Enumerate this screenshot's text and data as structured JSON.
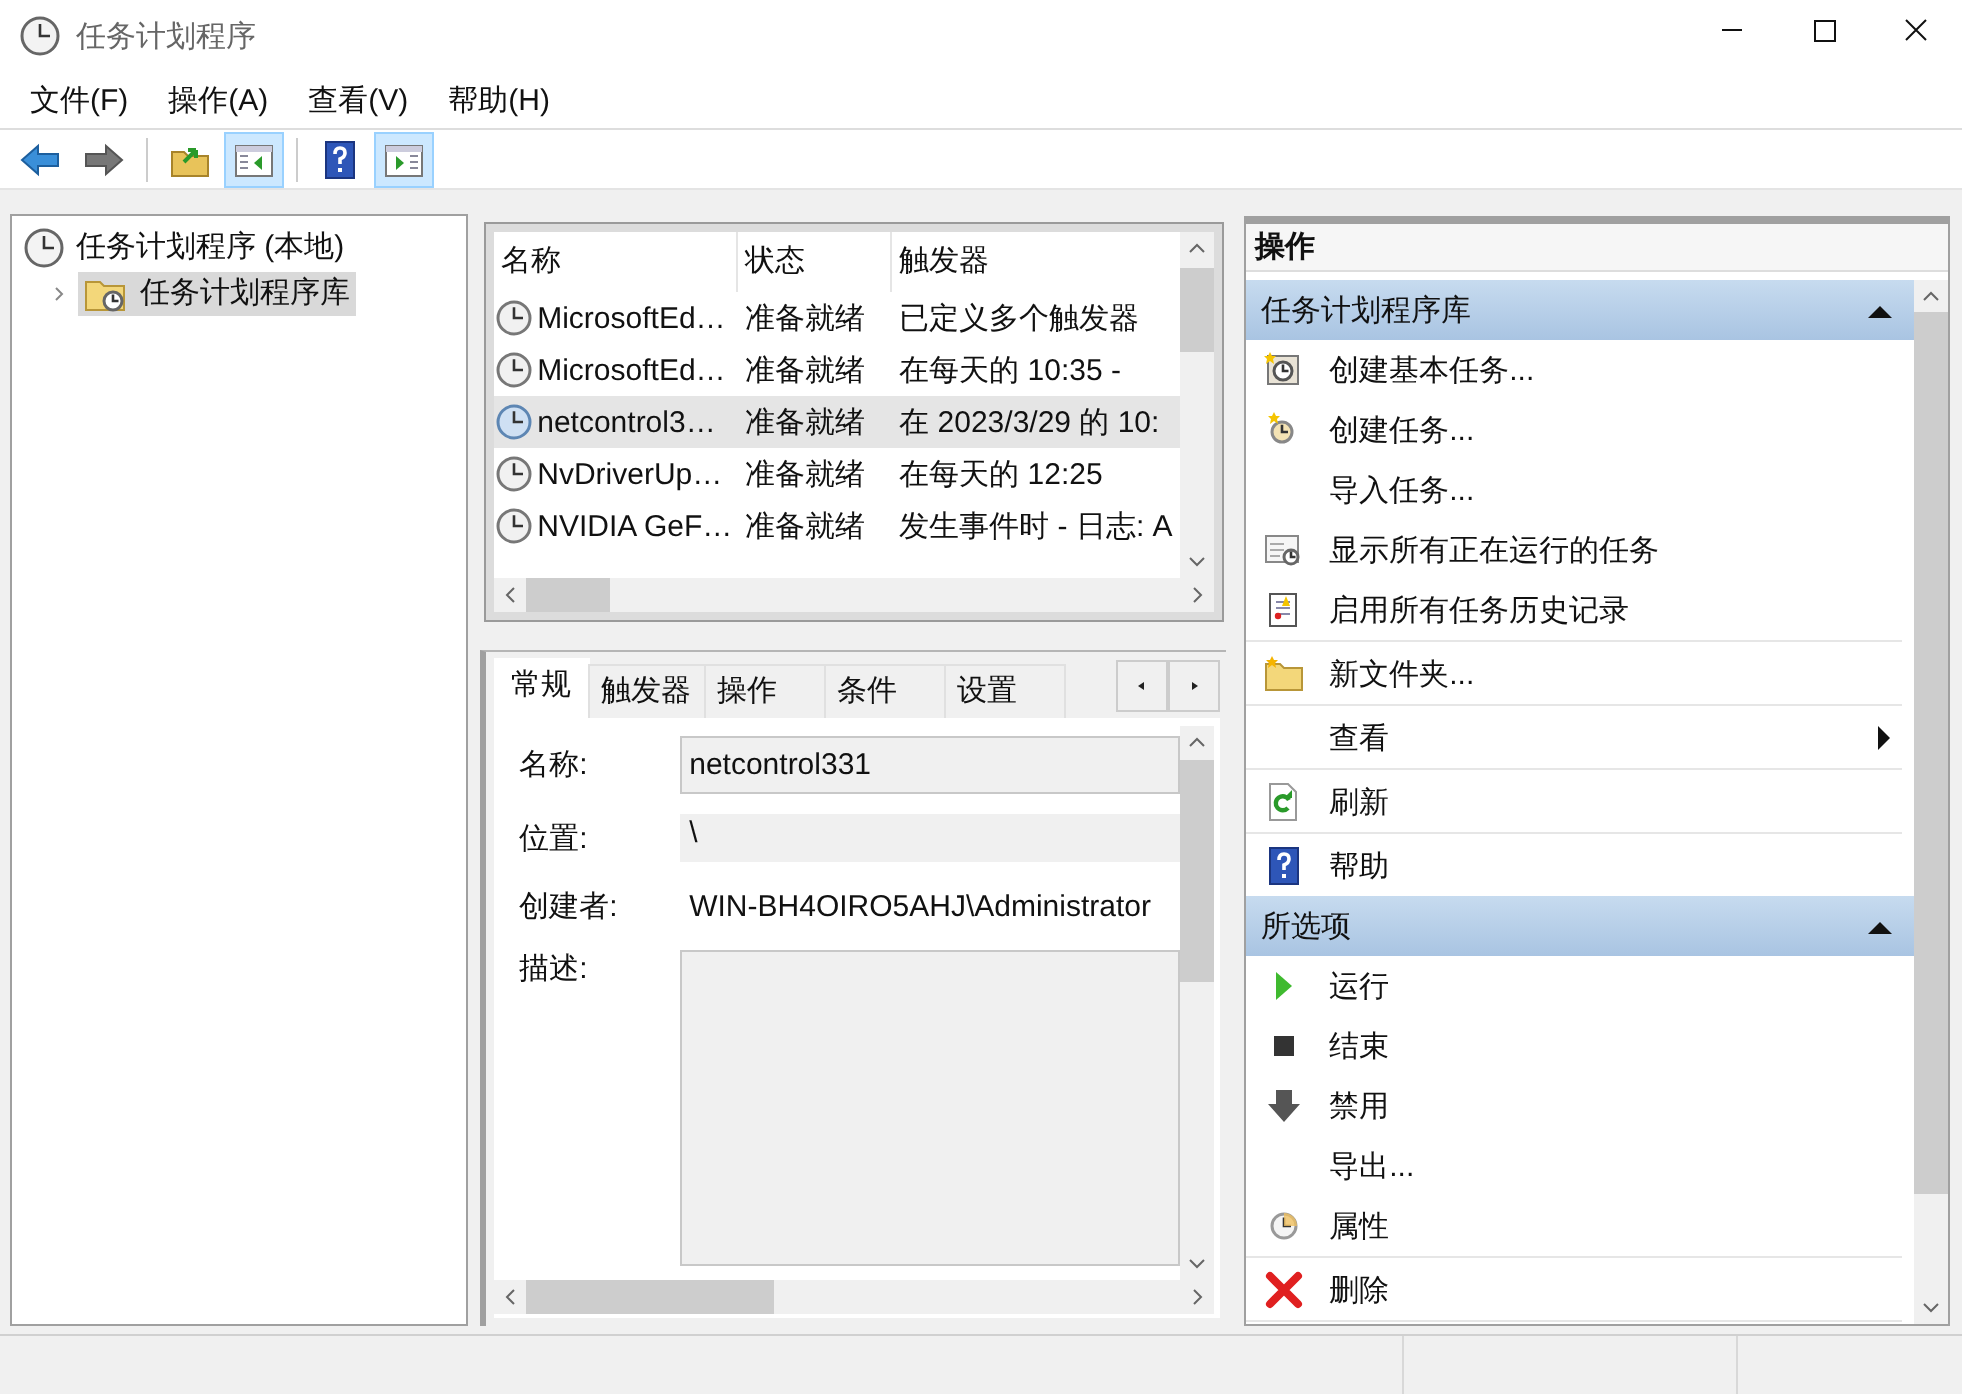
{
  "window": {
    "title": "任务计划程序"
  },
  "menu": [
    "文件(F)",
    "操作(A)",
    "查看(V)",
    "帮助(H)"
  ],
  "toolbar": [
    {
      "disabled": false
    },
    {
      "disabled": true
    },
    {
      "on": false
    },
    {
      "on": true
    },
    {
      "on": false
    },
    {
      "on": true
    }
  ],
  "tree": {
    "label": "任务计划程序 (本地)",
    "selected": false,
    "children": [
      {
        "label": "任务计划程序库",
        "selected": true,
        "expanded": false
      }
    ]
  },
  "task_list": {
    "columns": [
      "名称",
      "状态",
      "触发器"
    ],
    "rows": [
      {
        "name": "MicrosoftEd…",
        "status": "准备就绪",
        "trigger": "已定义多个触发器",
        "selected": false
      },
      {
        "name": "MicrosoftEd…",
        "status": "准备就绪",
        "trigger": "在每天的 10:35 -",
        "selected": false
      },
      {
        "name": "netcontrol3…",
        "status": "准备就绪",
        "trigger": "在 2023/3/29 的 10:",
        "selected": true
      },
      {
        "name": "NvDriverUp…",
        "status": "准备就绪",
        "trigger": "在每天的 12:25",
        "selected": false
      },
      {
        "name": "NVIDIA GeF…",
        "status": "准备就绪",
        "trigger": "发生事件时 - 日志: A",
        "selected": false
      }
    ]
  },
  "details": {
    "tabs": [
      {
        "label": "常规",
        "selected": true
      },
      {
        "label": "触发器",
        "selected": false
      },
      {
        "label": "操作",
        "selected": false
      },
      {
        "label": "条件",
        "selected": false
      },
      {
        "label": "设置",
        "selected": false
      }
    ],
    "fields": [
      {
        "label": "名称:",
        "kind": "input",
        "value": "netcontrol331"
      },
      {
        "label": "位置:",
        "kind": "readonly",
        "value": "\\"
      },
      {
        "label": "创建者:",
        "kind": "text",
        "value": "WIN-BH4OIRO5AHJ\\Administrator"
      },
      {
        "label": "描述:",
        "kind": "textarea"
      }
    ]
  },
  "actions": {
    "title": "操作",
    "sections": [
      {
        "title": "任务计划程序库",
        "expanded": true,
        "items": [
          {
            "label": "创建基本任务...",
            "divider_after": false,
            "submenu": false
          },
          {
            "label": "创建任务...",
            "divider_after": false,
            "submenu": false
          },
          {
            "label": "导入任务...",
            "divider_after": false,
            "submenu": false
          },
          {
            "label": "显示所有正在运行的任务",
            "divider_after": false,
            "submenu": false
          },
          {
            "label": "启用所有任务历史记录",
            "divider_after": true,
            "submenu": false
          },
          {
            "label": "新文件夹...",
            "divider_after": true,
            "submenu": false
          },
          {
            "label": "查看",
            "divider_after": true,
            "submenu": true
          },
          {
            "label": "刷新",
            "divider_after": true,
            "submenu": false
          },
          {
            "label": "帮助",
            "divider_after": false,
            "submenu": false
          }
        ]
      },
      {
        "title": "所选项",
        "expanded": true,
        "items": [
          {
            "label": "运行",
            "divider_after": false,
            "submenu": false
          },
          {
            "label": "结束",
            "divider_after": false,
            "submenu": false
          },
          {
            "label": "禁用",
            "divider_after": false,
            "submenu": false
          },
          {
            "label": "导出...",
            "divider_after": false,
            "submenu": false
          },
          {
            "label": "属性",
            "divider_after": true,
            "submenu": false
          },
          {
            "label": "删除",
            "divider_after": true,
            "submenu": false
          }
        ]
      }
    ]
  }
}
